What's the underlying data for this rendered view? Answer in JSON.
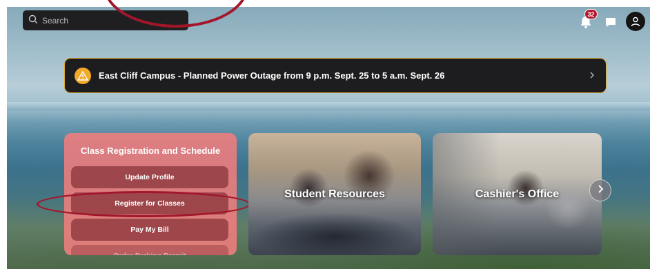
{
  "search": {
    "placeholder": "Search"
  },
  "notifications": {
    "count": "32"
  },
  "alert": {
    "text": "East Cliff Campus - Planned Power Outage from 9 p.m. Sept. 25 to 5 a.m. Sept. 26"
  },
  "registration_card": {
    "title": "Class Registration and Schedule",
    "buttons": [
      "Update Profile",
      "Register for Classes",
      "Pay My Bill",
      "Order Parking Permit"
    ]
  },
  "tiles": {
    "student_resources": "Student Resources",
    "cashiers_office": "Cashier's Office"
  },
  "icons": {
    "search": "search-icon",
    "bell": "bell-icon",
    "chat": "chat-icon",
    "user": "user-icon",
    "warning": "warning-icon",
    "chevron": "chevron-right-icon"
  },
  "colors": {
    "annotation": "#a3162a",
    "alert_border": "#d9a72d",
    "warning": "#f2a928",
    "card": "#f07d7d",
    "badge": "#b3172b"
  }
}
